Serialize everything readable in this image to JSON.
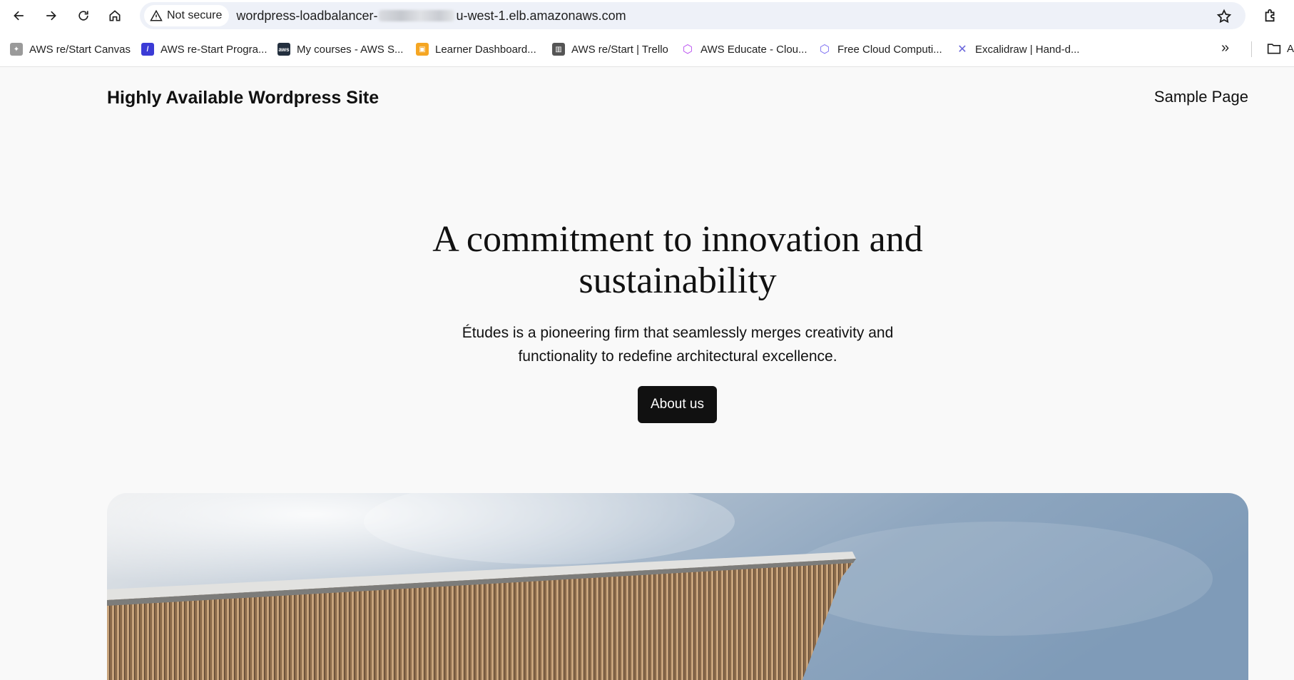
{
  "browser": {
    "security_label": "Not secure",
    "url_prefix": "wordpress-loadbalancer-",
    "url_suffix": "u-west-1.elb.amazonaws.com",
    "bookmarks": [
      {
        "label": "AWS re/Start Canvas",
        "icon": "canvas-favicon-icon",
        "color": "#8a8a8a"
      },
      {
        "label": "AWS re-Start Progra...",
        "icon": "aws-restart-favicon-icon",
        "color": "#3b3bd6"
      },
      {
        "label": "My courses - AWS S...",
        "icon": "aws-favicon-icon",
        "color": "#232f3e"
      },
      {
        "label": "Learner Dashboard...",
        "icon": "box-favicon-icon",
        "color": "#f5a623"
      },
      {
        "label": "AWS re/Start | Trello",
        "icon": "trello-favicon-icon",
        "color": "#555555"
      },
      {
        "label": "AWS Educate - Clou...",
        "icon": "cube-favicon-icon",
        "color": "#b84cf0"
      },
      {
        "label": "Free Cloud Computi...",
        "icon": "cube-favicon-icon",
        "color": "#7a6cf2"
      },
      {
        "label": "Excalidraw | Hand-d...",
        "icon": "excalidraw-favicon-icon",
        "color": "#6965db"
      }
    ],
    "folder_label": "A"
  },
  "site": {
    "title": "Highly Available Wordpress Site",
    "nav_link": "Sample Page"
  },
  "hero": {
    "heading": "A commitment to innovation and sustainability",
    "text": "Études is a pioneering firm that seamlessly merges creativity and functionality to redefine architectural excellence.",
    "button_label": "About us"
  },
  "colors": {
    "page_background": "#f9f9f9",
    "button_background": "#111111",
    "omnibox_background": "#eef1f8"
  }
}
